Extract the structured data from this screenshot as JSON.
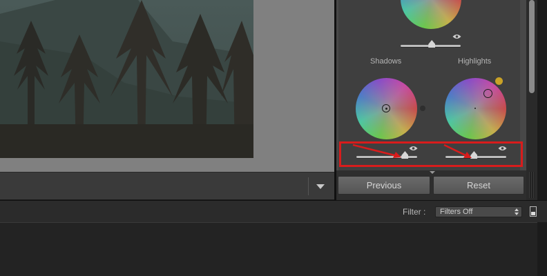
{
  "tone_panel": {
    "shadows_label": "Shadows",
    "highlights_label": "Highlights",
    "midtones_luminance": 0.52,
    "shadows_luminance": 0.8,
    "highlights_luminance": 0.47
  },
  "buttons": {
    "previous": "Previous",
    "reset": "Reset"
  },
  "filter_bar": {
    "label": "Filter :",
    "value": "Filters Off"
  },
  "colors": {
    "annotation": "#d81c1c",
    "highlight_indicator": "#c9a227"
  },
  "icons": {
    "visibility": "eye-icon",
    "toolbar_menu": "triangle-down-icon"
  }
}
